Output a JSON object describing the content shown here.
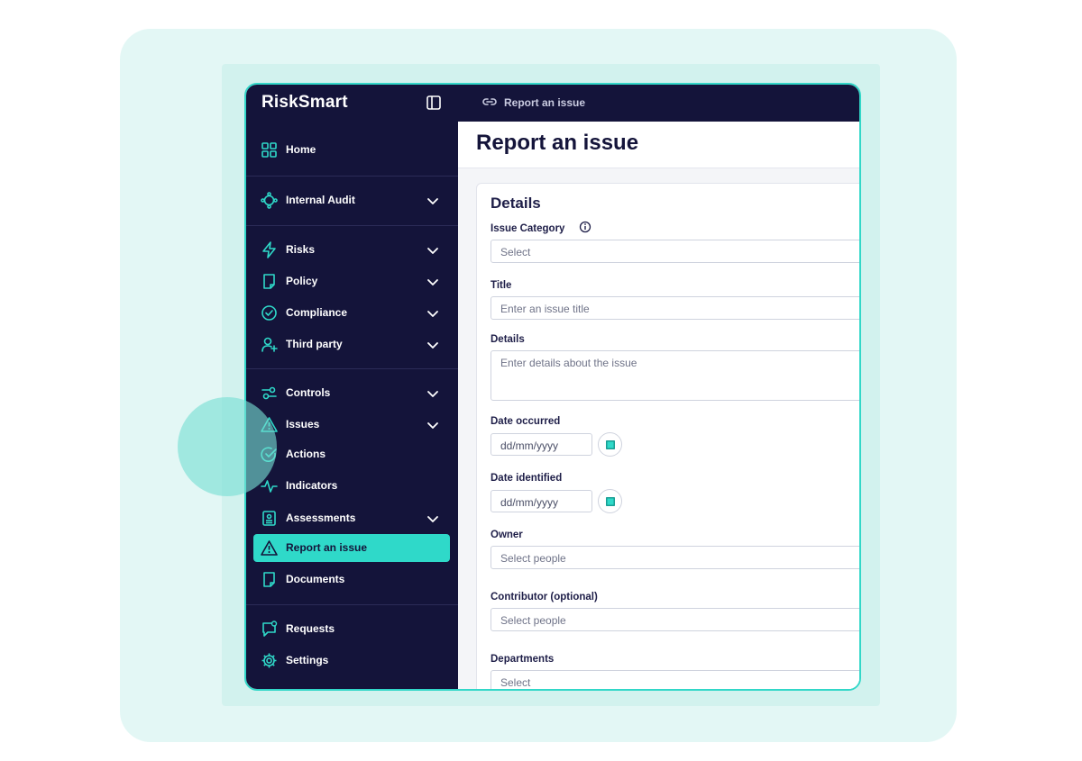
{
  "app": {
    "brand": "RiskSmart"
  },
  "topbar": {
    "breadcrumb": "Report an issue"
  },
  "sidebar": {
    "items": [
      {
        "label": "Home"
      },
      {
        "label": "Internal Audit"
      },
      {
        "label": "Risks"
      },
      {
        "label": "Policy"
      },
      {
        "label": "Compliance"
      },
      {
        "label": "Third party"
      },
      {
        "label": "Controls"
      },
      {
        "label": "Issues"
      },
      {
        "label": "Actions"
      },
      {
        "label": "Indicators"
      },
      {
        "label": "Assessments"
      },
      {
        "label": "Report an issue",
        "active": true
      },
      {
        "label": "Documents"
      },
      {
        "label": "Requests"
      },
      {
        "label": "Settings"
      }
    ]
  },
  "page": {
    "title": "Report an issue"
  },
  "form": {
    "section_title": "Details",
    "issue_category": {
      "label": "Issue Category",
      "placeholder": "Select"
    },
    "title": {
      "label": "Title",
      "placeholder": "Enter an issue title"
    },
    "details": {
      "label": "Details",
      "placeholder": "Enter details about the issue"
    },
    "date_occurred": {
      "label": "Date occurred",
      "placeholder": "dd/mm/yyyy"
    },
    "date_identified": {
      "label": "Date identified",
      "placeholder": "dd/mm/yyyy"
    },
    "owner": {
      "label": "Owner",
      "placeholder": "Select people"
    },
    "contributor": {
      "label": "Contributor (optional)",
      "placeholder": "Select people"
    },
    "departments": {
      "label": "Departments",
      "placeholder": "Select"
    }
  },
  "colors": {
    "accent": "#2fd9c9",
    "sidebar_bg": "#14143a",
    "background_outer": "#e3f7f5",
    "background_inner": "#d2f2ee"
  },
  "icons": {
    "home": "grid-icon",
    "internal_audit": "audit-icon",
    "risks": "lightning-icon",
    "policy": "document-icon",
    "compliance": "check-circle-icon",
    "third_party": "user-plus-icon",
    "controls": "sliders-icon",
    "issues": "warning-icon",
    "actions": "check-circle-icon",
    "indicators": "pulse-icon",
    "assessments": "clipboard-icon",
    "report_issue": "warning-icon",
    "documents": "document-icon",
    "requests": "chat-icon",
    "settings": "gear-icon"
  }
}
